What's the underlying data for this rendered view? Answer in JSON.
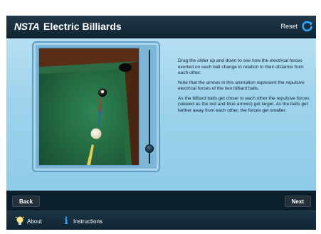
{
  "header": {
    "logo": "NSTA",
    "title": "Electric Billiards",
    "reset_label": "Reset"
  },
  "description": {
    "p1": "Drag the slider up and down to see how the electrical forces exerted on each ball change in relation to their distance from each other.",
    "p2a": "Note that the arrows in this animation represent the ",
    "p2b": "repulsive",
    "p2c": " electrical forces of the two billiard balls.",
    "p3": "As the billiard balls get closer to each other the repulsive forces (viewed as the red and blue arrows) get larger. As the balls get farther away from each other, the forces get smaller."
  },
  "slider": {
    "value": 0.1
  },
  "nav": {
    "back_label": "Back",
    "next_label": "Next"
  },
  "footer": {
    "about_label": "About",
    "instructions_label": "Instructions"
  },
  "colors": {
    "felt": "#1f6b40",
    "arrow_red": "#c0322a",
    "arrow_blue": "#2a5cc0",
    "accent": "#2ea6ff"
  },
  "icons": {
    "reset": "refresh-icon",
    "about": "lightbulb-icon",
    "instructions": "info-icon"
  }
}
